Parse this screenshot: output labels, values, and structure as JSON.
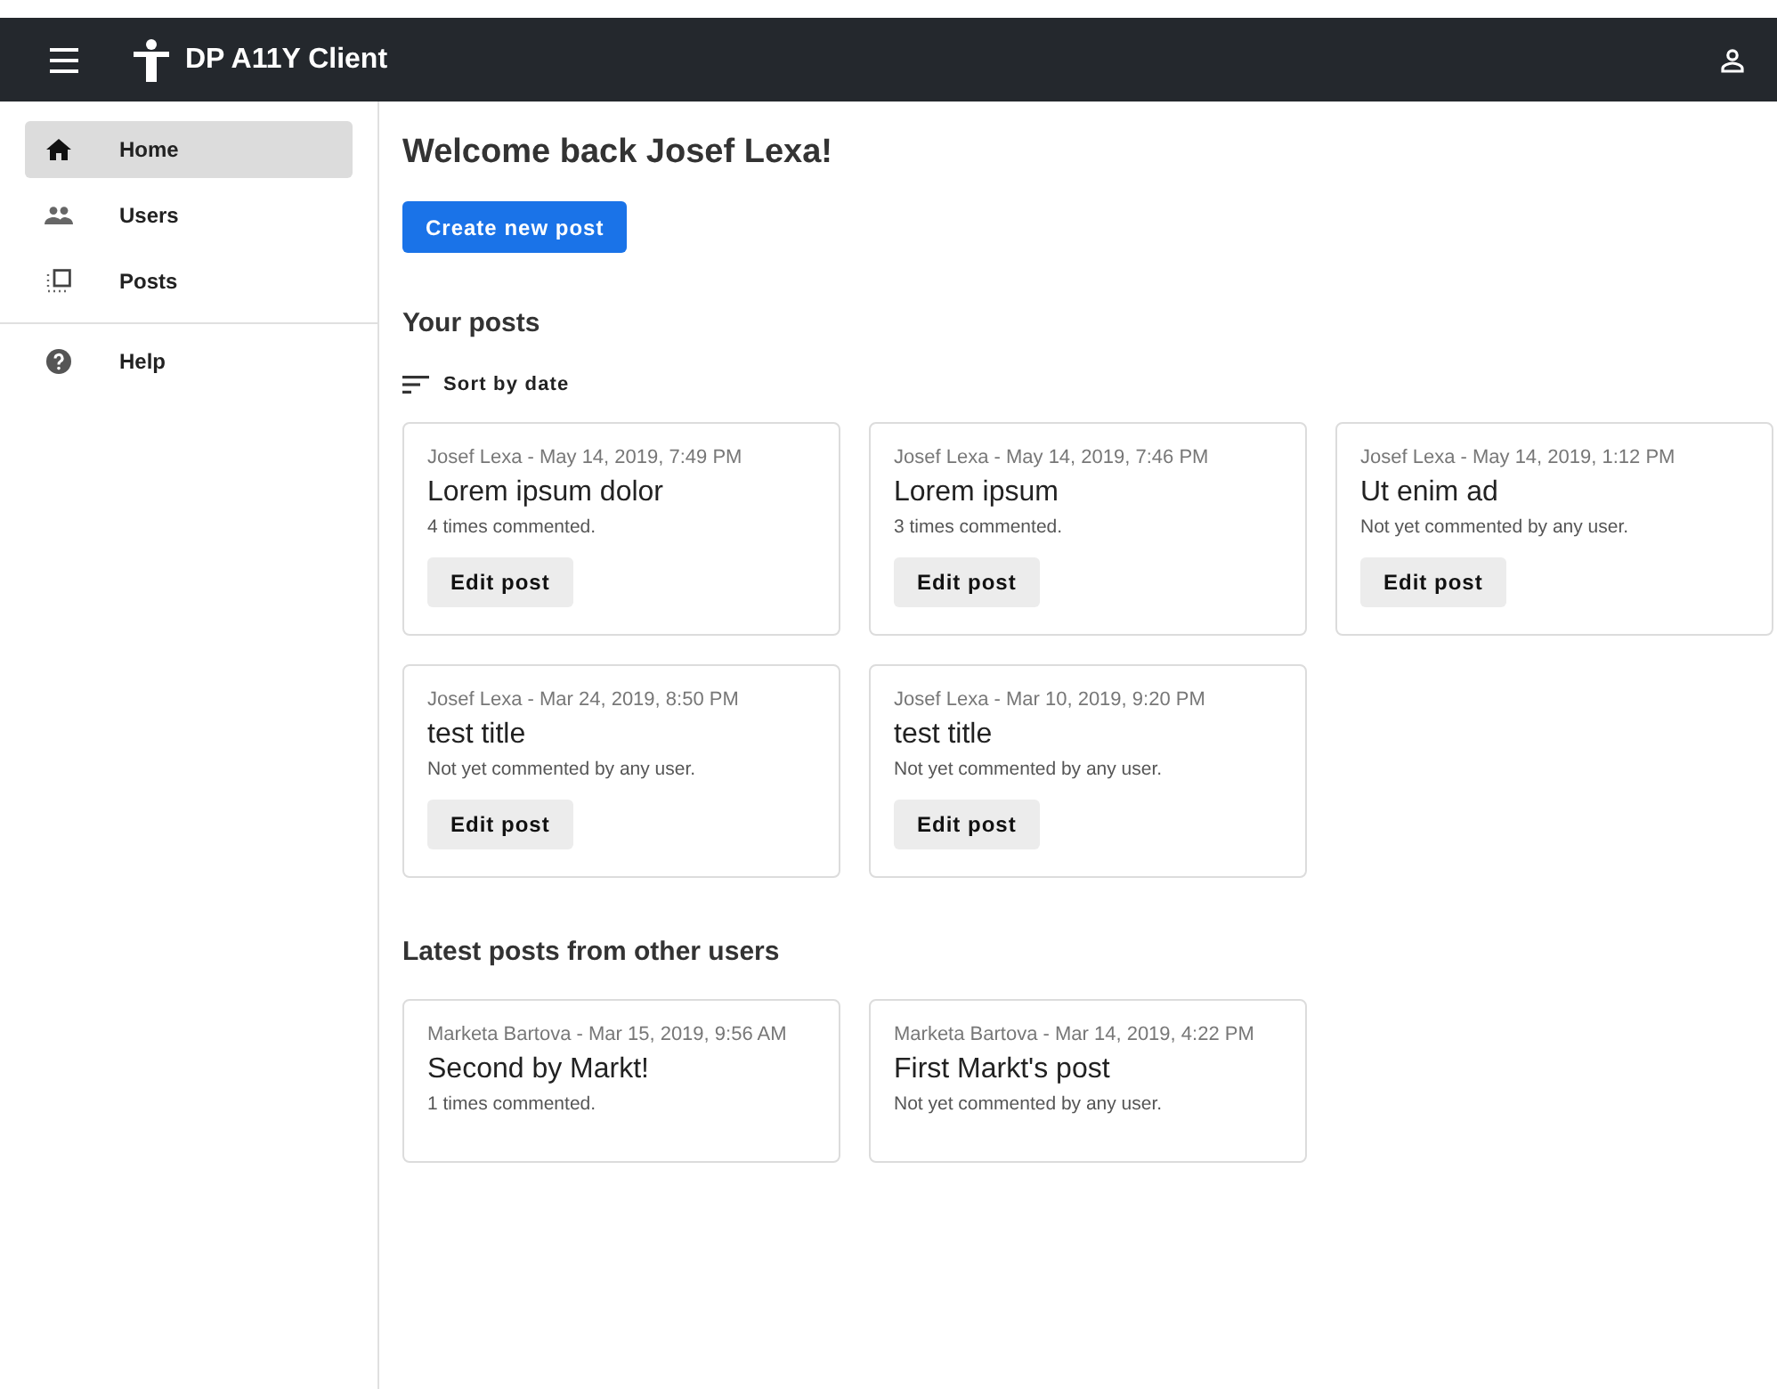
{
  "app_bar": {
    "title": "DP A11Y Client"
  },
  "sidebar": {
    "main_items": [
      {
        "label": "Home",
        "selected": true
      },
      {
        "label": "Users",
        "selected": false
      },
      {
        "label": "Posts",
        "selected": false
      }
    ],
    "secondary_items": [
      {
        "label": "Help",
        "selected": false
      }
    ]
  },
  "welcome": "Welcome back Josef Lexa!",
  "create_button": "Create new post",
  "your_posts": {
    "heading": "Your posts",
    "sort_label": "Sort by date",
    "posts": [
      {
        "meta": "Josef Lexa - May 14, 2019, 7:49 PM",
        "title": "Lorem ipsum dolor",
        "comments": "4 times commented.",
        "button": "Edit post"
      },
      {
        "meta": "Josef Lexa - May 14, 2019, 7:46 PM",
        "title": "Lorem ipsum",
        "comments": "3 times commented.",
        "button": "Edit post"
      },
      {
        "meta": "Josef Lexa - May 14, 2019, 1:12 PM",
        "title": "Ut enim ad",
        "comments": "Not yet commented by any user.",
        "button": "Edit post"
      },
      {
        "meta": "Josef Lexa - Mar 24, 2019, 8:50 PM",
        "title": "test title",
        "comments": "Not yet commented by any user.",
        "button": "Edit post"
      },
      {
        "meta": "Josef Lexa - Mar 10, 2019, 9:20 PM",
        "title": "test title",
        "comments": "Not yet commented by any user.",
        "button": "Edit post"
      }
    ]
  },
  "other_posts": {
    "heading": "Latest posts from other users",
    "posts": [
      {
        "meta": "Marketa Bartova - Mar 15, 2019, 9:56 AM",
        "title": "Second by Markt!",
        "comments": "1 times commented."
      },
      {
        "meta": "Marketa Bartova - Mar 14, 2019, 4:22 PM",
        "title": "First Markt's post",
        "comments": "Not yet commented by any user."
      }
    ]
  }
}
